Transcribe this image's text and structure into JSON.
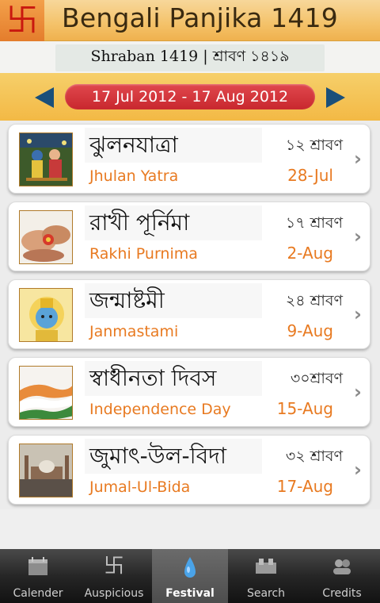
{
  "header": {
    "logo_glyph": "卐",
    "title": "Bengali Panjika 1419"
  },
  "month_bar": {
    "label": "Shraban 1419  |  শ্রাবণ ১৪১৯"
  },
  "date_range": {
    "label": "17 Jul 2012 - 17 Aug 2012",
    "prev_icon": "triangle-left",
    "next_icon": "triangle-right"
  },
  "festivals": [
    {
      "bn_name": "ঝুলনযাত্রা",
      "en_name": "Jhulan Yatra",
      "bn_date": "১২ শ্রাবণ",
      "en_date": "28-Jul",
      "thumb": "radha-krishna-swing"
    },
    {
      "bn_name": "রাখী পূর্নিমা",
      "en_name": "Rakhi Purnima",
      "bn_date": "১৭ শ্রাবণ",
      "en_date": "2-Aug",
      "thumb": "rakhi-tying"
    },
    {
      "bn_name": "জন্মাষ্টমী",
      "en_name": "Janmastami",
      "bn_date": "২৪ শ্রাবণ",
      "en_date": "9-Aug",
      "thumb": "baby-krishna"
    },
    {
      "bn_name": "স্বাধীনতা দিবস",
      "en_name": "Independence Day",
      "bn_date": "৩০শ্রাবণ",
      "en_date": "15-Aug",
      "thumb": "indian-flag"
    },
    {
      "bn_name": "জুমাৎ-উল-বিদা",
      "en_name": "Jumal-Ul-Bida",
      "bn_date": "৩২ শ্রাবণ",
      "en_date": "17-Aug",
      "thumb": "mosque"
    }
  ],
  "tabs": [
    {
      "label": "Calender",
      "icon": "calendar-icon",
      "active": false
    },
    {
      "label": "Auspicious",
      "icon": "swastika-icon",
      "active": false
    },
    {
      "label": "Festival",
      "icon": "lamp-icon",
      "active": true
    },
    {
      "label": "Search",
      "icon": "search-icon",
      "active": false
    },
    {
      "label": "Credits",
      "icon": "people-icon",
      "active": false
    }
  ],
  "colors": {
    "header_orange": "#f4c269",
    "accent_orange": "#e87a21",
    "pill_red": "#c8272e",
    "arrow_blue": "#1a4f7a"
  }
}
